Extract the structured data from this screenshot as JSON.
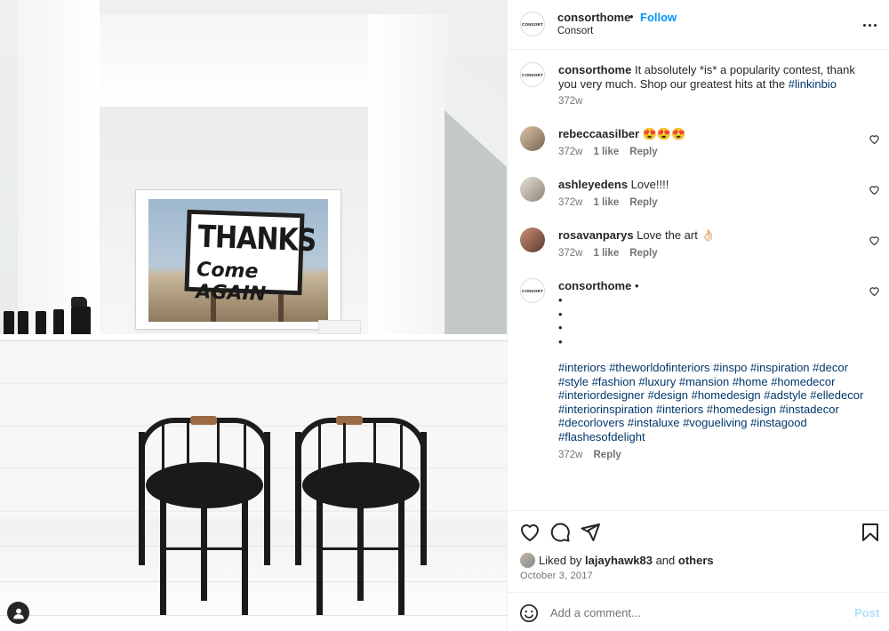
{
  "photo": {
    "sign_line1": "THANKS",
    "sign_line2": "Come AGAIN"
  },
  "header": {
    "username": "consorthome",
    "separator": "•",
    "follow_label": "Follow",
    "subtitle": "Consort",
    "logo_text": "CONSORT"
  },
  "caption": {
    "username": "consorthome",
    "text": "It absolutely *is* a popularity contest, thank you very much. Shop our greatest hits at the",
    "hashtag": "#linkinbio",
    "time": "372w"
  },
  "comments": [
    {
      "username": "rebeccaasilber",
      "text": "😍😍😍",
      "time": "372w",
      "likes": "1 like",
      "reply": "Reply"
    },
    {
      "username": "ashleyedens",
      "text": "Love!!!!",
      "time": "372w",
      "likes": "1 like",
      "reply": "Reply"
    },
    {
      "username": "rosavanparys",
      "text": "Love the art 👌🏻",
      "time": "372w",
      "likes": "1 like",
      "reply": "Reply"
    }
  ],
  "hashtag_comment": {
    "username": "consorthome",
    "dots": [
      "•",
      "•",
      "•",
      "•",
      "•"
    ],
    "hashtags": "#interiors #theworldofinteriors #inspo #inspiration #decor #style #fashion #luxury #mansion #home #homedecor #interiordesigner #design #homedesign #adstyle #elledecor #interiorinspiration #interiors #homedesign #instadecor #decorlovers #instaluxe #vogueliving #instagood #flashesofdelight",
    "time": "372w",
    "reply": "Reply"
  },
  "likes": {
    "prefix": "Liked by",
    "user": "lajayhawk83",
    "and": "and",
    "others": "others"
  },
  "post_date": "October 3, 2017",
  "composer": {
    "placeholder": "Add a comment...",
    "post_label": "Post"
  },
  "colors": {
    "link_blue": "#0095f6",
    "hashtag_blue": "#00376b",
    "muted": "#737373",
    "post_disabled": "#b2dffc"
  },
  "icons": [
    "heart-icon",
    "comment-icon",
    "share-icon",
    "bookmark-icon",
    "more-icon",
    "emoji-icon",
    "small-heart-icon",
    "profile-icon"
  ]
}
